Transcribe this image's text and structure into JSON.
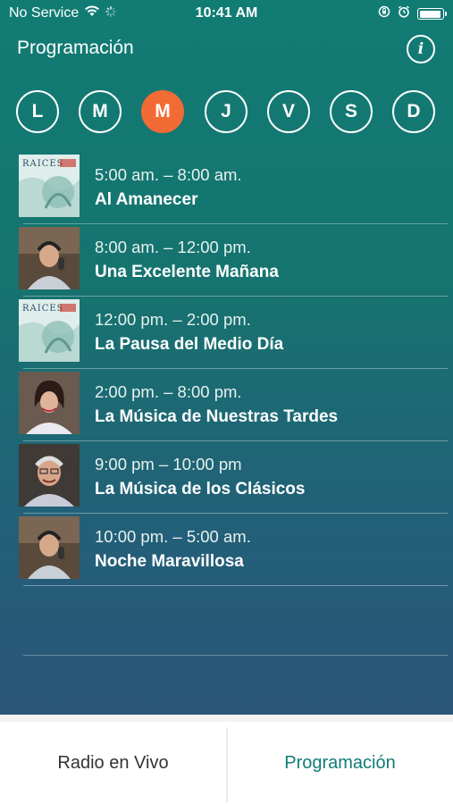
{
  "status": {
    "carrier": "No Service",
    "time": "10:41 AM"
  },
  "header": {
    "title": "Programación",
    "info_label": "i"
  },
  "days": [
    {
      "label": "L",
      "active": false
    },
    {
      "label": "M",
      "active": false
    },
    {
      "label": "M",
      "active": true
    },
    {
      "label": "J",
      "active": false
    },
    {
      "label": "V",
      "active": false
    },
    {
      "label": "S",
      "active": false
    },
    {
      "label": "D",
      "active": false
    }
  ],
  "schedule": [
    {
      "time": "5:00 am. – 8:00 am.",
      "title": "Al Amanecer",
      "image": "raices-logo"
    },
    {
      "time": "8:00 am. – 12:00 pm.",
      "title": "Una Excelente Mañana",
      "image": "host-photo-older-man"
    },
    {
      "time": "12:00 pm. – 2:00 pm.",
      "title": "La Pausa del Medio Día",
      "image": "raices-logo"
    },
    {
      "time": "2:00 pm. – 8:00 pm.",
      "title": "La Música de Nuestras Tardes",
      "image": "host-photo-woman"
    },
    {
      "time": "9:00 pm – 10:00 pm",
      "title": "La Música de los Clásicos",
      "image": "host-photo-man-glasses"
    },
    {
      "time": "10:00 pm. – 5:00 am.",
      "title": "Noche Maravillosa",
      "image": "host-photo-older-man"
    }
  ],
  "logo_text": "RAICES",
  "tabs": {
    "live": "Radio en Vivo",
    "schedule": "Programación"
  },
  "colors": {
    "accent": "#f26b34",
    "teal": "#117c74",
    "active_tab": "#117c74"
  }
}
